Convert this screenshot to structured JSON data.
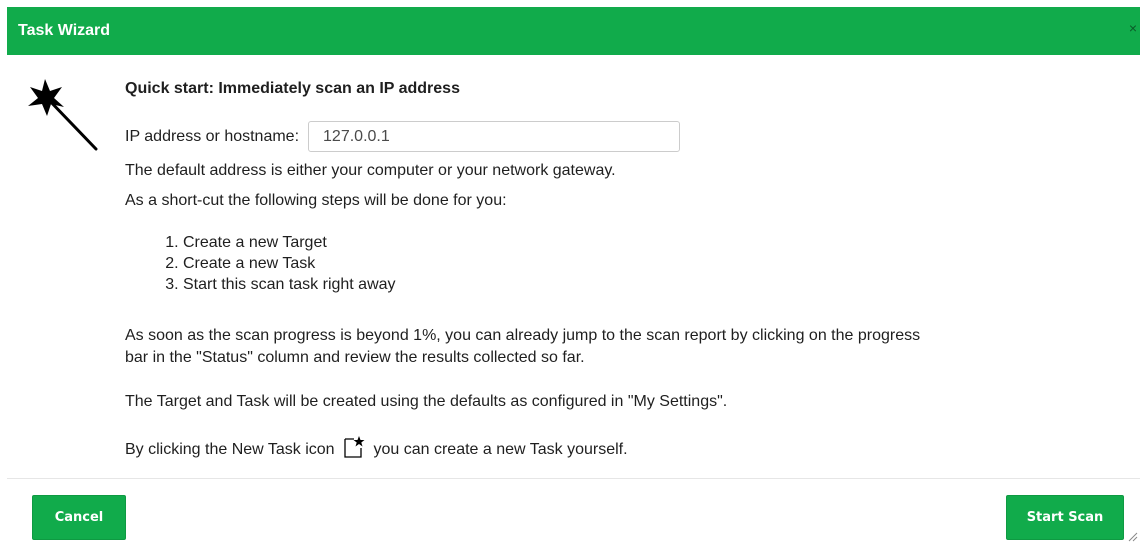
{
  "dialog": {
    "title": "Task Wizard",
    "close_label": "×"
  },
  "content": {
    "heading": "Quick start: Immediately scan an IP address",
    "ip_label": "IP address or hostname:",
    "ip_value": "127.0.0.1",
    "default_note": "The default address is either your computer or your network gateway.",
    "shortcut_note": "As a short-cut the following steps will be done for you:",
    "steps": [
      "Create a new Target",
      "Create a new Task",
      "Start this scan task right away"
    ],
    "progress_note_1": "As soon as the scan progress is beyond 1%, you can already jump to the scan report by clicking on the progress",
    "progress_note_2": "bar in the \"Status\" column and review the results collected so far.",
    "defaults_note": "The Target and Task will be created using the defaults as configured in \"My Settings\".",
    "newtask_prefix": "By clicking the New Task icon",
    "newtask_suffix": "you can create a new Task yourself."
  },
  "footer": {
    "cancel_label": "Cancel",
    "start_label": "Start Scan"
  },
  "icons": {
    "wizard": "magic-wand-icon",
    "new_task": "new-task-icon",
    "close": "close-icon",
    "resize": "resize-grip-icon"
  },
  "colors": {
    "accent": "#11ab4b"
  }
}
